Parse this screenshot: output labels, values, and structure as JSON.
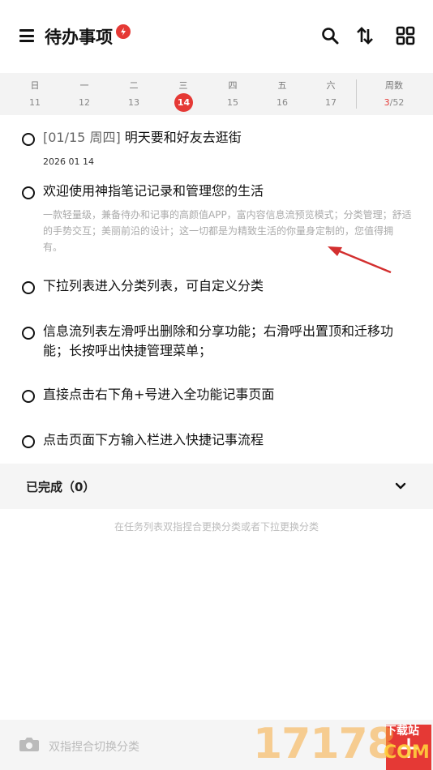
{
  "header": {
    "title": "待办事项",
    "icons": [
      "menu-icon",
      "flame-badge-icon",
      "search-icon",
      "sort-icon",
      "grid-icon"
    ]
  },
  "calendar": {
    "days": [
      {
        "name": "日",
        "num": "11"
      },
      {
        "name": "一",
        "num": "12"
      },
      {
        "name": "二",
        "num": "13"
      },
      {
        "name": "三",
        "num": "14",
        "today": true
      },
      {
        "name": "四",
        "num": "15"
      },
      {
        "name": "五",
        "num": "16"
      },
      {
        "name": "六",
        "num": "17"
      }
    ],
    "week_label": "周数",
    "week_current": "3",
    "week_total": "/52"
  },
  "tasks": [
    {
      "tag": "[01/15 周四]",
      "title": "明天要和好友去逛街",
      "date": "2026 01 14"
    },
    {
      "title": "欢迎使用神指笔记记录和管理您的生活",
      "desc": "一款轻量级，兼备待办和记事的高颜值APP，富内容信息流预览模式；分类管理；舒适的手势交互；美丽前沿的设计；这一切都是为精致生活的你量身定制的，您值得拥有。"
    },
    {
      "title": "下拉列表进入分类列表，可自定义分类"
    },
    {
      "title": "信息流列表左滑呼出删除和分享功能；右滑呼出置顶和迁移功能；长按呼出快捷管理菜单；"
    },
    {
      "title": "直接点击右下角+号进入全功能记事页面"
    },
    {
      "title": "点击页面下方输入栏进入快捷记事流程"
    }
  ],
  "completed": {
    "label": "已完成（0）"
  },
  "hint": "在任务列表双指捏合更换分类或者下拉更换分类",
  "bottom": {
    "placeholder": "双指捏合切换分类",
    "fab": "+"
  },
  "watermark": {
    "number": "17178",
    "text1": "下载站",
    "text2": "COM"
  },
  "colors": {
    "accent": "#e53935"
  }
}
